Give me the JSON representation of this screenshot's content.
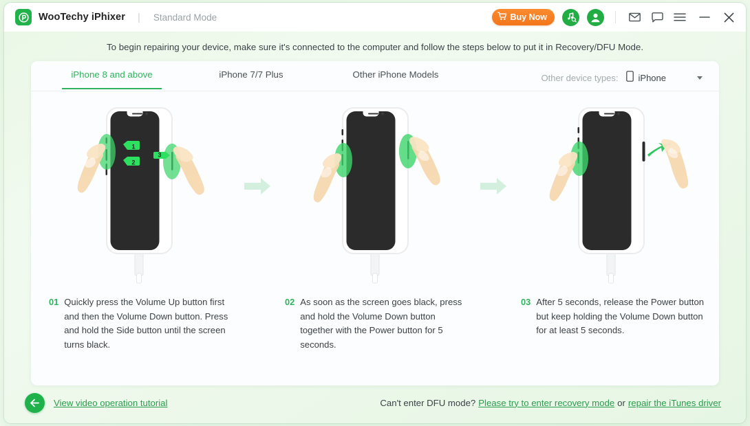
{
  "titlebar": {
    "logo_icon": "wootechy-logo-icon",
    "brand": "WooTechy iPhixer",
    "separator": "|",
    "mode": "Standard Mode",
    "buy_now": "Buy Now",
    "cart_icon": "cart-icon",
    "itunes_icon": "itunes-search-icon",
    "account_icon": "account-icon",
    "mail_icon": "mail-icon",
    "feedback_icon": "chat-icon",
    "menu_icon": "hamburger-menu-icon",
    "minimize_icon": "minimize-icon",
    "close_icon": "close-icon"
  },
  "intro": "To begin repairing your device, make sure it's connected to the computer and follow the steps below to put it in Recovery/DFU Mode.",
  "tabs": [
    {
      "label": "iPhone 8 and above",
      "active": true
    },
    {
      "label": "iPhone 7/7 Plus",
      "active": false
    },
    {
      "label": "Other iPhone Models",
      "active": false
    }
  ],
  "device_type": {
    "label": "Other device types:",
    "icon": "phone-icon",
    "value": "iPhone",
    "caret_icon": "chevron-down-icon"
  },
  "steps": [
    {
      "num": "01",
      "text": "Quickly press the Volume Up button first and then the Volume Down button. Press and hold the Side button until the screen turns black.",
      "illustration": "iphone-step-1-illustration",
      "badges": [
        "1",
        "2",
        "3"
      ]
    },
    {
      "num": "02",
      "text": "As soon as the screen goes black, press and hold the Volume Down button together with the Power button for 5 seconds.",
      "illustration": "iphone-step-2-illustration",
      "badges": []
    },
    {
      "num": "03",
      "text": "After 5 seconds, release the Power button but keep holding the Volume Down button for at least 5 seconds.",
      "illustration": "iphone-step-3-illustration",
      "badges": []
    }
  ],
  "arrow_icon": "right-arrow-icon",
  "footer": {
    "back_icon": "back-arrow-icon",
    "video_link": "View video operation tutorial",
    "question": "Can't enter DFU mode?",
    "link1": "Please try to enter recovery mode",
    "conjunction": "or",
    "link2": "repair the iTunes driver"
  },
  "colors": {
    "brand_green": "#22b24c",
    "accent_green": "#2eb35c",
    "buy_orange": "#f3751c",
    "arrow_mint": "#d3f0de",
    "screen_black": "#2b2b2b",
    "card_bg": "#fbfdfe"
  }
}
